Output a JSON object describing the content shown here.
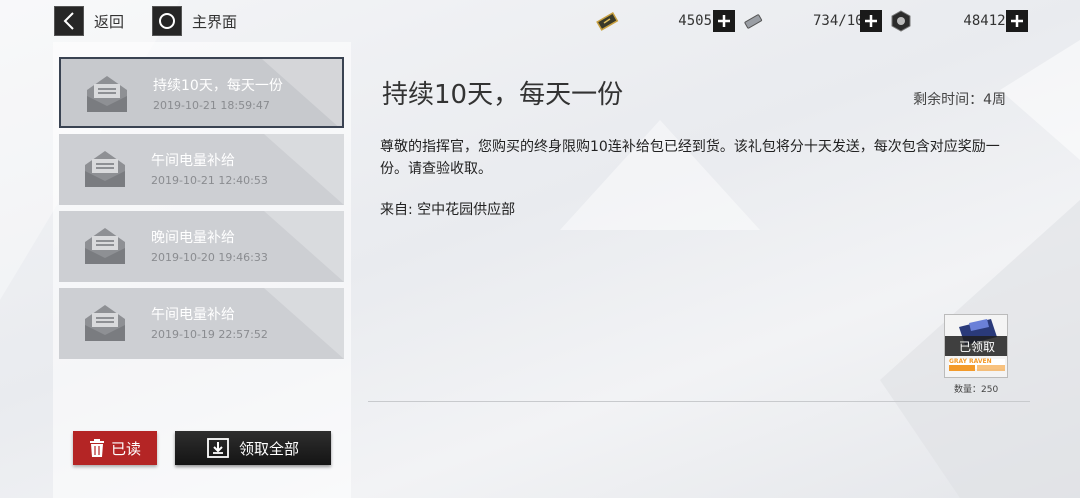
{
  "topbar": {
    "back_label": "返回",
    "home_label": "主界面",
    "resources": [
      {
        "icon": "ticket-icon",
        "value": "4505"
      },
      {
        "icon": "battery-icon",
        "value": "734/108"
      },
      {
        "icon": "hex-nut-icon",
        "value": "484124"
      }
    ]
  },
  "mail_list": [
    {
      "title": "持续10天，每天一份",
      "date": "2019-10-21 18:59:47",
      "selected": true
    },
    {
      "title": "午间电量补给",
      "date": "2019-10-21 12:40:53",
      "selected": false
    },
    {
      "title": "晚间电量补给",
      "date": "2019-10-20 19:46:33",
      "selected": false
    },
    {
      "title": "午间电量补给",
      "date": "2019-10-19 22:57:52",
      "selected": false
    }
  ],
  "actions": {
    "read_label": "已读",
    "claim_all_label": "领取全部"
  },
  "mail": {
    "title": "持续10天，每天一份",
    "remaining": "剩余时间：4周",
    "body": "尊敬的指挥官，您购买的终身限购10连补给包已经到货。该礼包将分十天发送，每次包含对应奖励一份。请查验收取。",
    "from": "来自: 空中花园供应部",
    "reward": {
      "status": "已领取",
      "brand_text": "GRAY RAVEN",
      "quantity": "数量：250"
    }
  },
  "colors": {
    "accent_red": "#b42525",
    "dark": "#1a1a1a",
    "selected_border": "#3a4352",
    "mail_card": "#cdcfd3"
  }
}
